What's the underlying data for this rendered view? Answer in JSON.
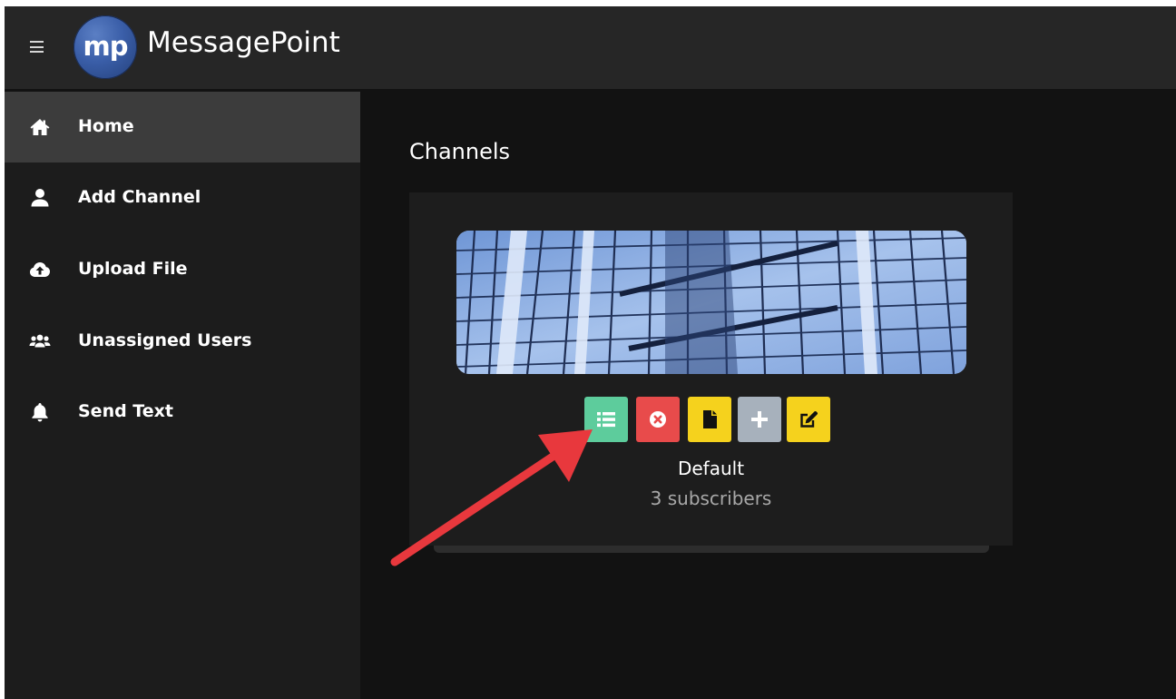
{
  "app": {
    "title": "MessagePoint",
    "logo_text": "mp"
  },
  "sidebar": {
    "items": [
      {
        "label": "Home",
        "icon": "home-icon",
        "active": true
      },
      {
        "label": "Add Channel",
        "icon": "user-icon",
        "active": false
      },
      {
        "label": "Upload File",
        "icon": "cloud-upload-icon",
        "active": false
      },
      {
        "label": "Unassigned Users",
        "icon": "users-icon",
        "active": false
      },
      {
        "label": "Send Text",
        "icon": "bell-icon",
        "active": false
      }
    ]
  },
  "main": {
    "title": "Channels",
    "channel": {
      "name": "Default",
      "subscribers": "3 subscribers",
      "actions": [
        {
          "icon": "list-icon",
          "color": "#5dcc9c"
        },
        {
          "icon": "times-circle-icon",
          "color": "#e84b4b"
        },
        {
          "icon": "file-icon",
          "color": "#f5d21d"
        },
        {
          "icon": "plus-icon",
          "color": "#a7b1bc"
        },
        {
          "icon": "edit-icon",
          "color": "#f5d21d"
        }
      ]
    }
  },
  "colors": {
    "topbar": "#262626",
    "sidebar": "#1c1c1c",
    "sidebar_active": "#3c3c3c",
    "content_bg": "#121212",
    "card": "#1d1d1d",
    "annotation_arrow": "#e8383d"
  }
}
